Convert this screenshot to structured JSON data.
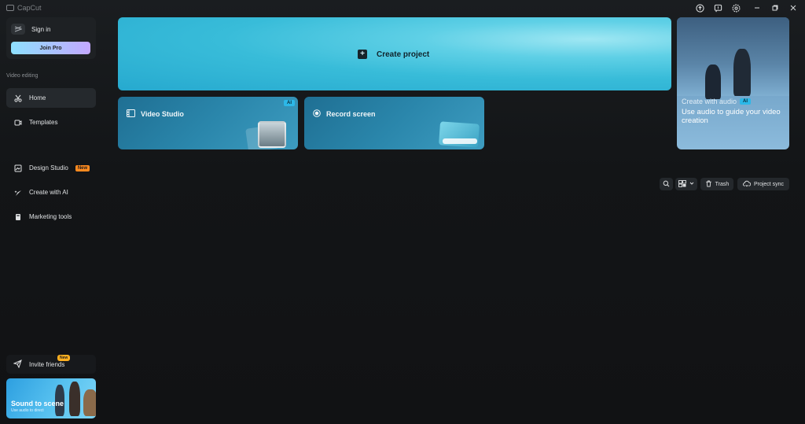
{
  "app": {
    "title": "CapCut"
  },
  "sidebar": {
    "signin_label": "Sign in",
    "joinpro_label": "Join Pro",
    "section_label": "Video editing",
    "items": [
      {
        "label": "Home",
        "icon": "scissors-icon"
      },
      {
        "label": "Templates",
        "icon": "templates-icon"
      },
      {
        "label": "Design Studio",
        "icon": "design-icon",
        "badge": "New"
      },
      {
        "label": "Create with AI",
        "icon": "sparkle-icon"
      },
      {
        "label": "Marketing tools",
        "icon": "marketing-icon"
      }
    ],
    "invite_label": "Invite friends",
    "invite_badge": "New",
    "promo": {
      "title": "Sound to scene",
      "subtitle": "Use audio to direct"
    }
  },
  "main": {
    "create_project_label": "Create project",
    "video_studio_label": "Video Studio",
    "video_studio_badge": "AI",
    "record_screen_label": "Record screen",
    "audio_card": {
      "title": "Create with audio",
      "badge": "AI",
      "subtitle": "Use audio to guide your video creation"
    }
  },
  "toolbar": {
    "trash_label": "Trash",
    "project_sync_label": "Project sync"
  },
  "colors": {
    "accent": "#38bcd9",
    "new_badge": "#ff8a1f",
    "background": "#131517"
  }
}
